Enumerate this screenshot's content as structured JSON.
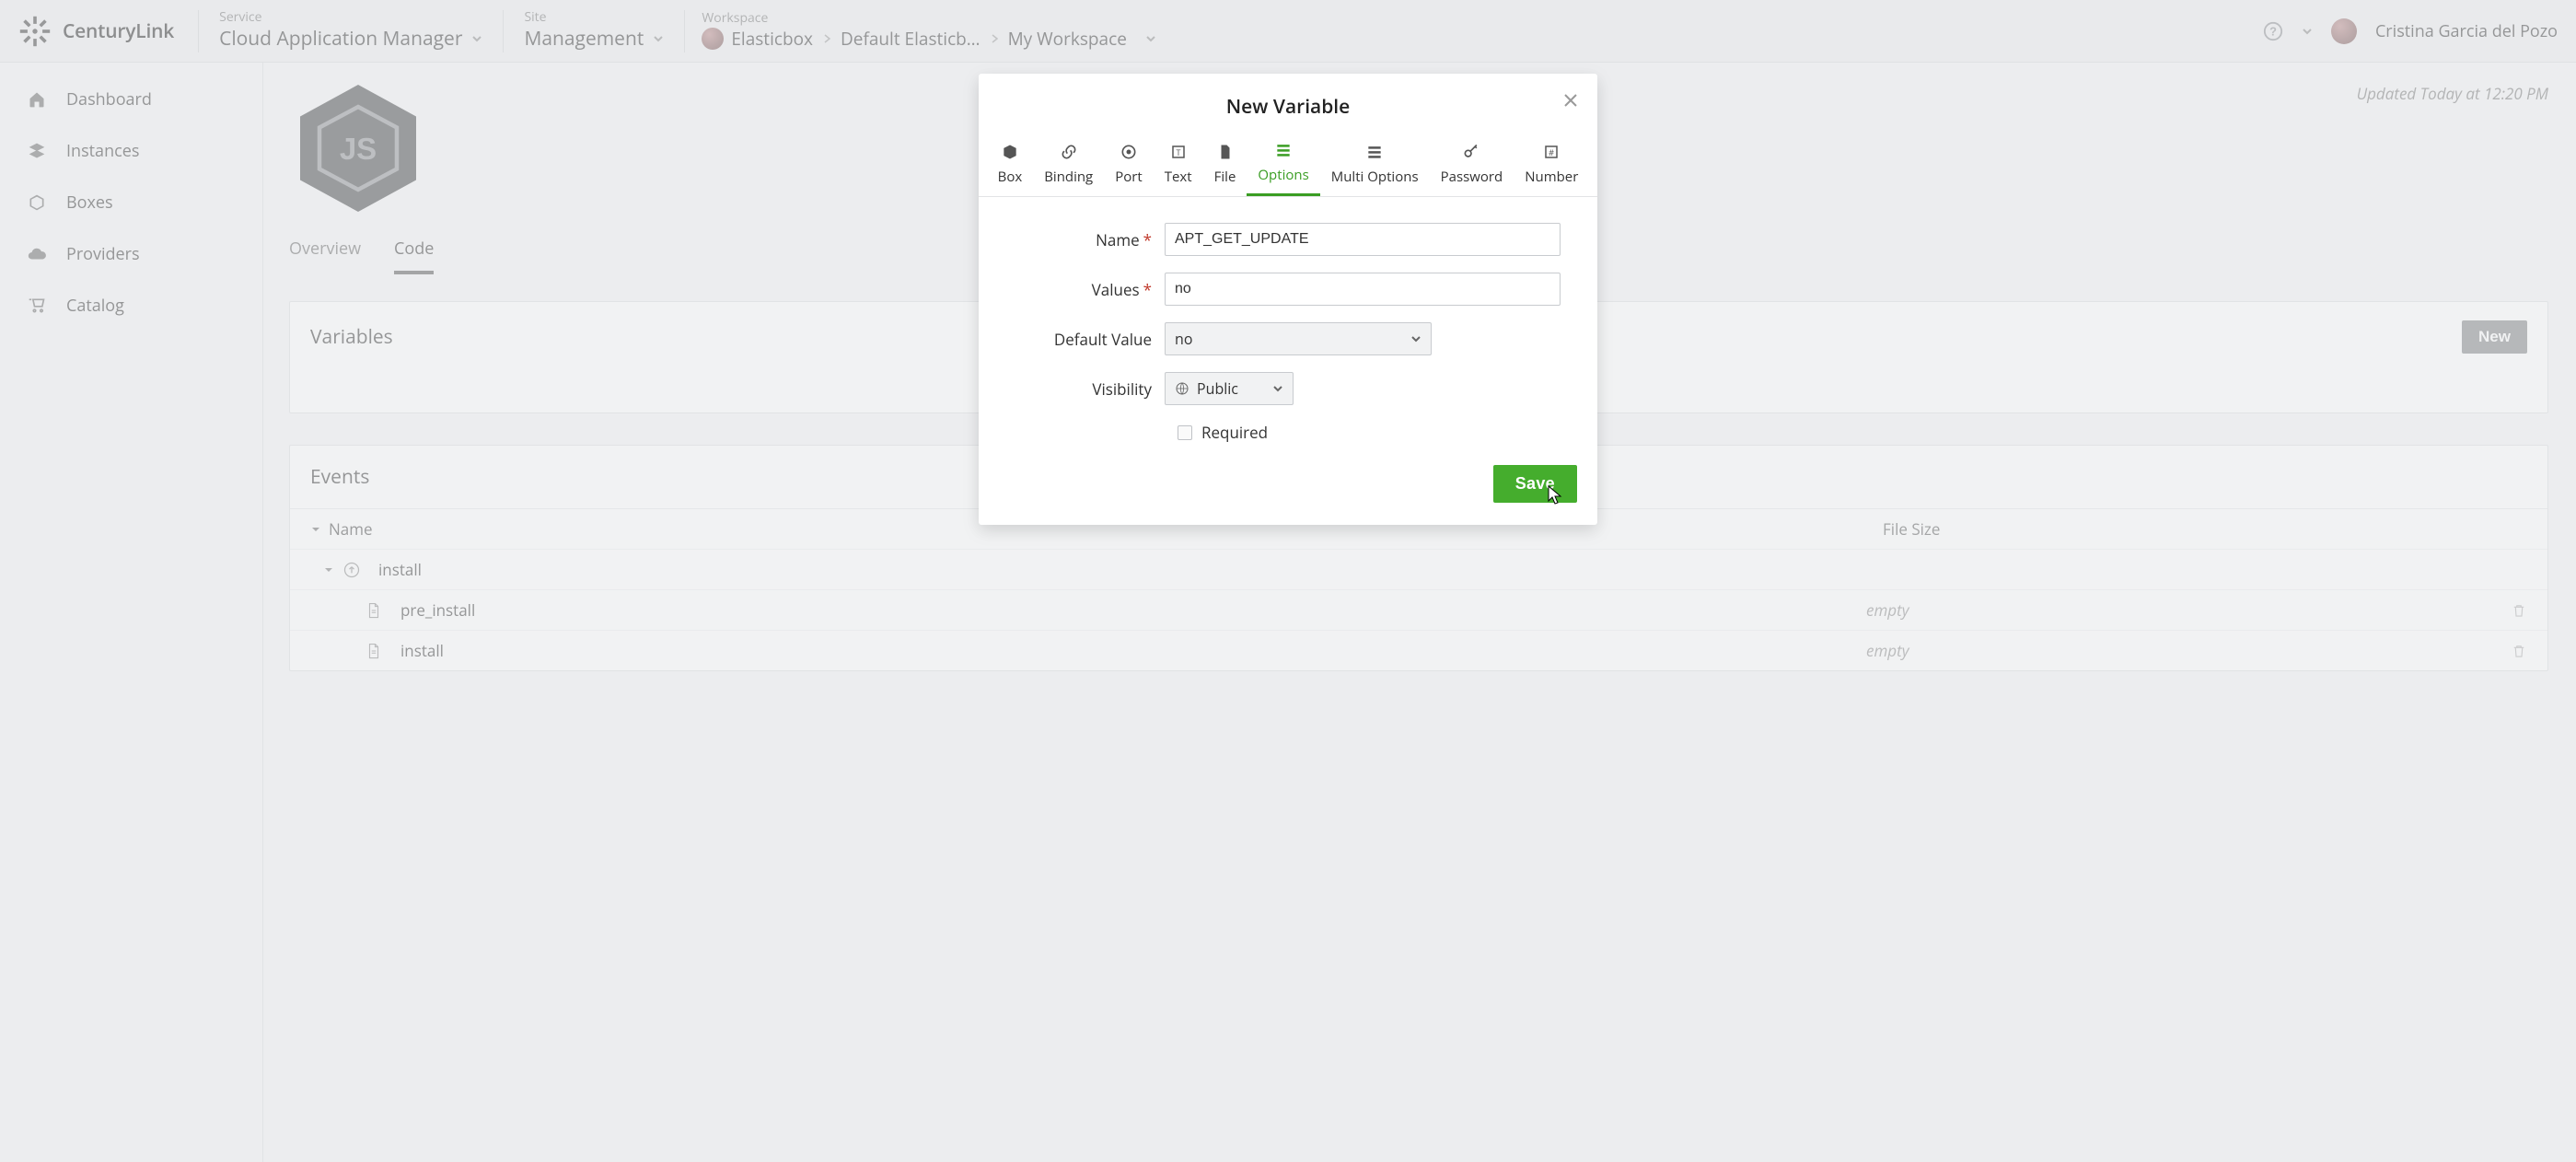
{
  "brand": {
    "name": "CenturyLink"
  },
  "header": {
    "service": {
      "label": "Service",
      "value": "Cloud Application Manager"
    },
    "site": {
      "label": "Site",
      "value": "Management"
    },
    "workspace": {
      "label": "Workspace",
      "crumbs": [
        "Elasticbox",
        "Default Elasticb…",
        "My Workspace"
      ]
    },
    "user": "Cristina Garcia del Pozo"
  },
  "sidebar": {
    "items": [
      {
        "icon": "home",
        "label": "Dashboard"
      },
      {
        "icon": "layers",
        "label": "Instances"
      },
      {
        "icon": "box",
        "label": "Boxes"
      },
      {
        "icon": "cloud",
        "label": "Providers"
      },
      {
        "icon": "cart",
        "label": "Catalog"
      }
    ]
  },
  "main": {
    "updated": "Updated Today at 12:20 PM",
    "tabs": [
      "Overview",
      "Code"
    ],
    "active_tab": 1,
    "variables_panel": {
      "title": "Variables",
      "new_btn": "New"
    },
    "events_panel": {
      "title": "Events",
      "columns": {
        "name": "Name",
        "size": "File Size"
      },
      "rows": [
        {
          "level": 1,
          "icon": "arrow-up-circle",
          "label": "install"
        },
        {
          "level": 2,
          "icon": "file",
          "label": "pre_install",
          "size": "empty"
        },
        {
          "level": 2,
          "icon": "file",
          "label": "install",
          "size": "empty"
        }
      ]
    }
  },
  "modal": {
    "title": "New Variable",
    "types": [
      "Box",
      "Binding",
      "Port",
      "Text",
      "File",
      "Options",
      "Multi Options",
      "Password",
      "Number"
    ],
    "active_type": 5,
    "fields": {
      "name_label": "Name",
      "name_value": "APT_GET_UPDATE",
      "values_label": "Values",
      "values_value": "no",
      "default_label": "Default Value",
      "default_value": "no",
      "visibility_label": "Visibility",
      "visibility_value": "Public",
      "required_label": "Required"
    },
    "save": "Save"
  }
}
